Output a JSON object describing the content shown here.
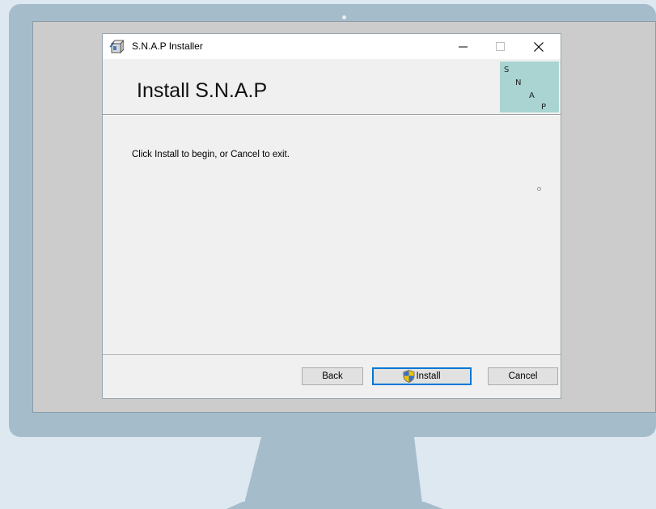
{
  "window": {
    "title": "S.N.A.P Installer",
    "app_icon": "installer-package-icon",
    "controls": {
      "minimize_icon": "minimize-icon",
      "maximize_icon": "maximize-icon",
      "close_icon": "close-icon"
    }
  },
  "header": {
    "title": "Install S.N.A.P",
    "logo_letters": [
      "S",
      "N",
      "A",
      "P"
    ],
    "logo_color": "#a9d4d2"
  },
  "content": {
    "instruction": "Click Install to begin, or Cancel to exit."
  },
  "buttons": {
    "back": "Back",
    "install": "Install",
    "install_icon": "uac-shield-icon",
    "cancel": "Cancel"
  }
}
